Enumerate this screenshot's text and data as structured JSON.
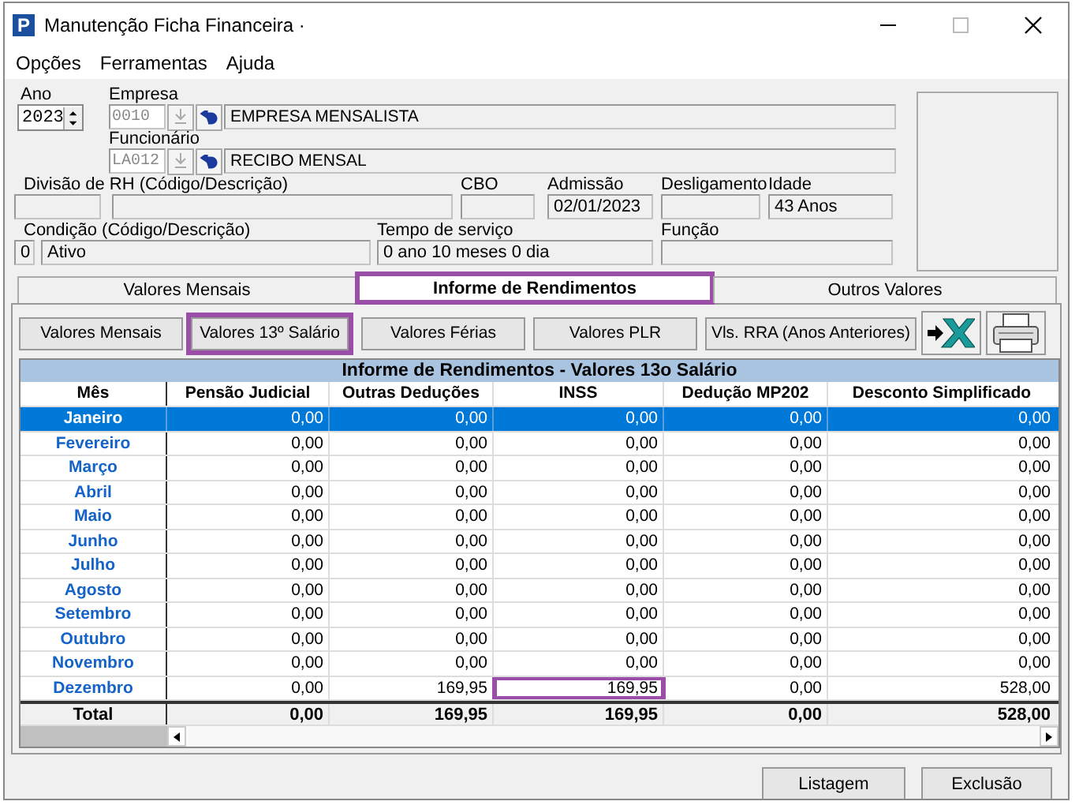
{
  "window": {
    "logo": "P",
    "title": "Manutenção Ficha Financeira ·"
  },
  "menu": [
    "Opções",
    "Ferramentas",
    "Ajuda"
  ],
  "form": {
    "ano": {
      "label": "Ano",
      "value": "2023"
    },
    "empresa": {
      "label": "Empresa",
      "code": "0010",
      "name": "EMPRESA MENSALISTA"
    },
    "funcionario": {
      "label": "Funcionário",
      "code": "LA012",
      "name": "RECIBO MENSAL"
    },
    "divisao": {
      "label": "Divisão de RH (Código/Descrição)"
    },
    "cbo": {
      "label": "CBO"
    },
    "admissao": {
      "label": "Admissão",
      "value": "02/01/2023"
    },
    "desligamento": {
      "label": "Desligamento"
    },
    "idade": {
      "label": "Idade",
      "value": "43 Anos"
    },
    "condicao": {
      "label": "Condição (Código/Descrição)",
      "code": "0",
      "name": "Ativo"
    },
    "tempo": {
      "label": "Tempo de serviço",
      "value": "0 ano 10 meses 0 dia"
    },
    "funcao": {
      "label": "Função"
    }
  },
  "tabs": [
    {
      "label": "Valores Mensais",
      "selected": false,
      "highlighted": false
    },
    {
      "label": "Informe de Rendimentos",
      "selected": true,
      "highlighted": true
    },
    {
      "label": "Outros Valores",
      "selected": false,
      "highlighted": false
    }
  ],
  "buttons": [
    {
      "label": "Valores Mensais",
      "highlighted": false
    },
    {
      "label": "Valores 13º Salário",
      "highlighted": true
    },
    {
      "label": "Valores Férias",
      "highlighted": false
    },
    {
      "label": "Valores PLR",
      "highlighted": false
    },
    {
      "label": "Vls. RRA (Anos Anteriores)",
      "highlighted": false
    }
  ],
  "table": {
    "title": "Informe de Rendimentos - Valores 13o Salário",
    "columns": [
      "Mês",
      "Pensão Judicial",
      "Outras Deduções",
      "INSS",
      "Dedução MP202",
      "Desconto Simplificado"
    ],
    "rows": [
      {
        "selected": true,
        "cells": [
          "Janeiro",
          "0,00",
          "0,00",
          "0,00",
          "0,00",
          "0,00"
        ]
      },
      {
        "selected": false,
        "cells": [
          "Fevereiro",
          "0,00",
          "0,00",
          "0,00",
          "0,00",
          "0,00"
        ]
      },
      {
        "selected": false,
        "cells": [
          "Março",
          "0,00",
          "0,00",
          "0,00",
          "0,00",
          "0,00"
        ]
      },
      {
        "selected": false,
        "cells": [
          "Abril",
          "0,00",
          "0,00",
          "0,00",
          "0,00",
          "0,00"
        ]
      },
      {
        "selected": false,
        "cells": [
          "Maio",
          "0,00",
          "0,00",
          "0,00",
          "0,00",
          "0,00"
        ]
      },
      {
        "selected": false,
        "cells": [
          "Junho",
          "0,00",
          "0,00",
          "0,00",
          "0,00",
          "0,00"
        ]
      },
      {
        "selected": false,
        "cells": [
          "Julho",
          "0,00",
          "0,00",
          "0,00",
          "0,00",
          "0,00"
        ]
      },
      {
        "selected": false,
        "cells": [
          "Agosto",
          "0,00",
          "0,00",
          "0,00",
          "0,00",
          "0,00"
        ]
      },
      {
        "selected": false,
        "cells": [
          "Setembro",
          "0,00",
          "0,00",
          "0,00",
          "0,00",
          "0,00"
        ]
      },
      {
        "selected": false,
        "cells": [
          "Outubro",
          "0,00",
          "0,00",
          "0,00",
          "0,00",
          "0,00"
        ]
      },
      {
        "selected": false,
        "cells": [
          "Novembro",
          "0,00",
          "0,00",
          "0,00",
          "0,00",
          "0,00"
        ]
      },
      {
        "selected": false,
        "cells": [
          "Dezembro",
          "0,00",
          "169,95",
          "169,95",
          "0,00",
          "528,00"
        ],
        "highlight": [
          false,
          false,
          false,
          true,
          false,
          false
        ]
      }
    ],
    "total": [
      "Total",
      "0,00",
      "169,95",
      "169,95",
      "0,00",
      "528,00"
    ]
  },
  "footer_buttons": [
    "Listagem",
    "Exclusão"
  ]
}
